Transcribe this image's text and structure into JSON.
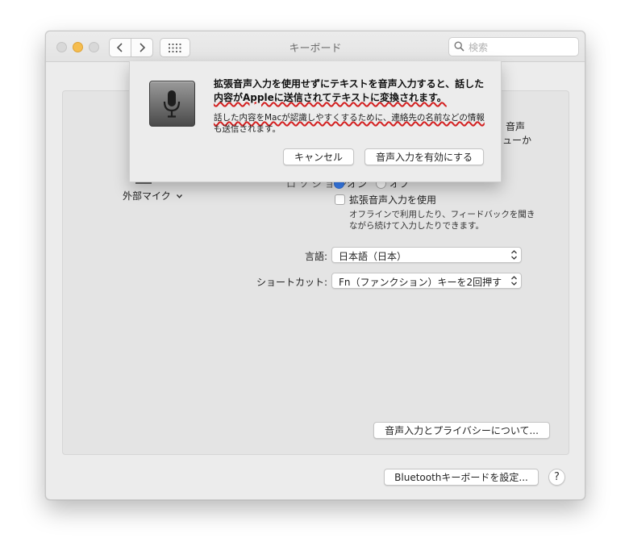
{
  "window": {
    "title": "キーボード",
    "search_placeholder": "検索"
  },
  "panel": {
    "input_source_label": "外部マイク",
    "right_partial_1": "音声",
    "right_partial_2": "ューか",
    "dictation_label_partial": "ロ ソ シ ョ ン:",
    "radio_on_label": "オン",
    "radio_off_label": "オフ",
    "enhanced_checkbox_label": "拡張音声入力を使用",
    "enhanced_desc_line1": "オフラインで利用したり、フィードバックを聞き",
    "enhanced_desc_line2": "ながら続けて入力したりできます。",
    "language_label": "言語:",
    "language_value": "日本語（日本）",
    "shortcut_label": "ショートカット:",
    "shortcut_value": "Fn（ファンクション）キーを2回押す",
    "privacy_button": "音声入力とプライバシーについて..."
  },
  "footer": {
    "bluetooth_button": "Bluetoothキーボードを設定...",
    "help_label": "?"
  },
  "sheet": {
    "title_line1": "拡張音声入力を使用せずにテキストを音声入力すると、話した",
    "title_line2": "内容がAppleに送信されてテキストに変換されます。",
    "body_line1": "話した内容をMacが認識しやすくするために、連絡先の名前などの情報",
    "body_line2": "も送信されます。",
    "cancel_button": "キャンセル",
    "enable_button": "音声入力を有効にする"
  },
  "colors": {
    "accent": "#3a82f7",
    "annotation_red": "#d32020",
    "traffic_yellow": "#f5bd4f"
  }
}
